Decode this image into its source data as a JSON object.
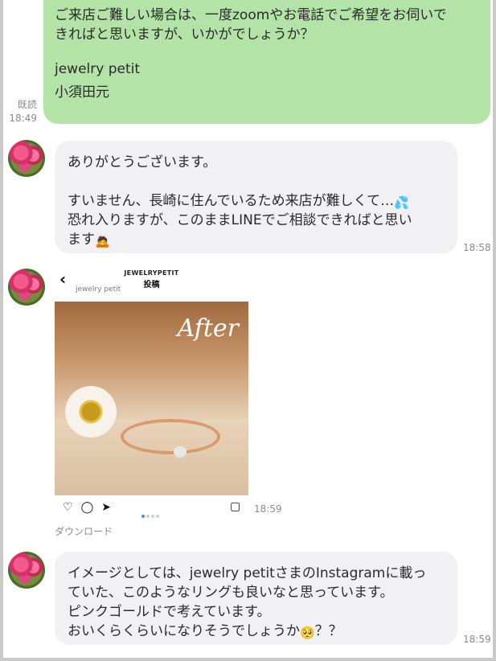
{
  "outgoing": {
    "lines": [
      "ご来店ご難しい場合は、一度zoomやお電話でご希望をお伺いで",
      "きればと思いますが、いかがでしょうか？",
      "jewelry petit",
      "小須田元"
    ],
    "read_label": "既読",
    "time": "18:49"
  },
  "msg1": {
    "lines": [
      "ありがとうございます。",
      "すいません、長崎に住んでいるため来店が難しくて…",
      "恐れ入りますが、このままLINEでご相談できればと思い",
      "ます"
    ],
    "emoji_sweat": "💦",
    "emoji_face": "🙇",
    "time": "18:58"
  },
  "image_msg": {
    "brand": "JEWELRYPETIT",
    "post_label": "投稿",
    "handle": "jewelry petit",
    "overlay_text": "After",
    "time": "18:59",
    "download_label": "ダウンロード"
  },
  "msg2": {
    "lines": [
      "イメージとしては、jewelry petitさまのInstagramに載っ",
      "ていた、このようなリングも良いなと思っています。",
      "ピンクゴールドで考えています。",
      "おいくらくらいになりそうでしょうか",
      "？？"
    ],
    "emoji_plead": "🥺",
    "time": "18:59"
  }
}
